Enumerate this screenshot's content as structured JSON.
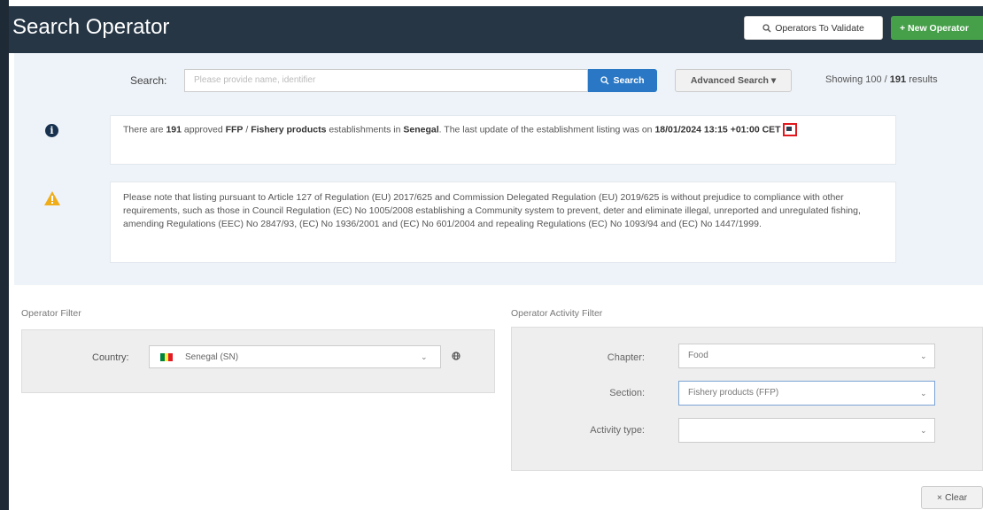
{
  "header": {
    "title": "Search Operator",
    "validate_button": "Operators To Validate",
    "new_button": "+ New Operator"
  },
  "search": {
    "label": "Search:",
    "placeholder": "Please provide name, identifier",
    "button": "Search",
    "advanced_button": "Advanced Search ▾",
    "showing_prefix": "Showing 100 / ",
    "showing_count": "191",
    "showing_suffix": " results"
  },
  "info": {
    "t1": "There are ",
    "count": "191",
    "t2": " approved ",
    "code": "FFP",
    "t3": " / ",
    "category": "Fishery products",
    "t4": " establishments in ",
    "country": "Senegal",
    "t5": ". The last update of the establishment listing was on ",
    "date": "18/01/2024 13:15 +01:00 CET"
  },
  "warning": {
    "text": "Please note that listing pursuant to Article 127 of Regulation (EU) 2017/625 and Commission Delegated Regulation (EU) 2019/625 is without prejudice to compliance with other requirements, such as those in Council Regulation (EC) No 1005/2008 establishing a Community system to prevent, deter and eliminate illegal, unreported and unregulated fishing, amending Regulations (EEC) No 2847/93, (EC) No 1936/2001 and (EC) No 601/2004 and repealing Regulations (EC) No 1093/94 and (EC) No 1447/1999."
  },
  "operator_filter": {
    "title": "Operator Filter",
    "country_label": "Country:",
    "country_value": "Senegal (SN)"
  },
  "activity_filter": {
    "title": "Operator Activity Filter",
    "chapter_label": "Chapter:",
    "chapter_value": "Food",
    "section_label": "Section:",
    "section_value": "Fishery products (FFP)",
    "activity_label": "Activity type:",
    "activity_value": ""
  },
  "clear_button": "× Clear",
  "colors": {
    "header_bg": "#263645",
    "search_button": "#2a78c5",
    "new_button": "#46a049",
    "warning": "#f0ad1a",
    "highlight": "#e0191e"
  }
}
